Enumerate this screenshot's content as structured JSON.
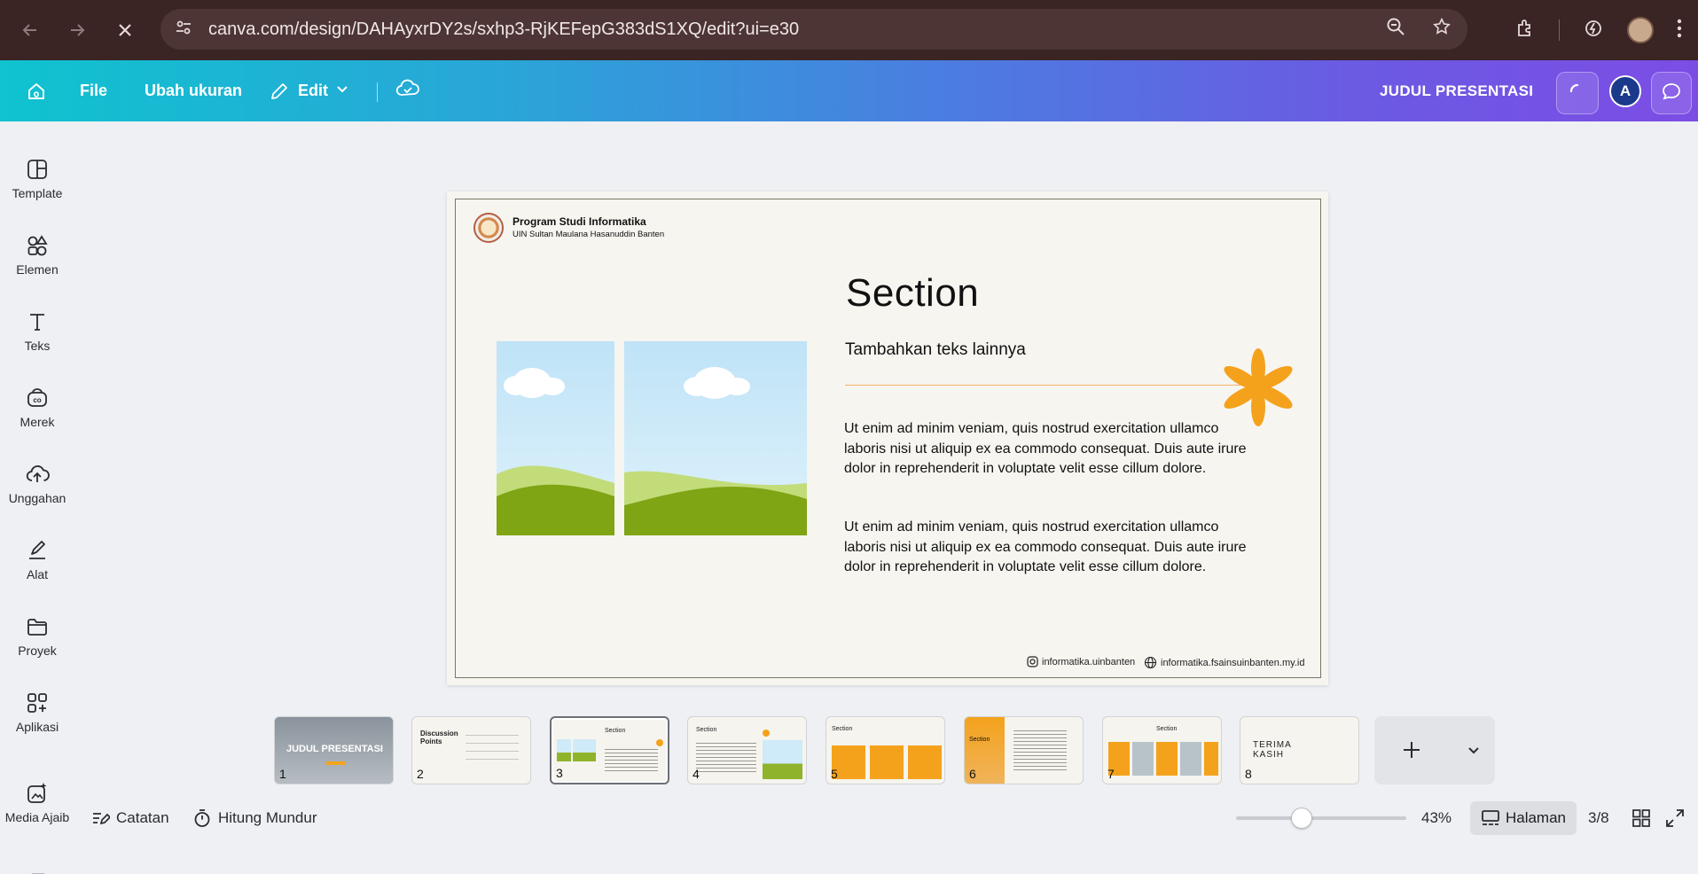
{
  "browser": {
    "url": "canva.com/design/DAHAyxrDY2s/sxhp3-RjKEFepG383dS1XQ/edit?ui=e30",
    "icons": [
      "back-icon",
      "forward-icon",
      "stop-icon",
      "site-settings-icon",
      "zoom-icon",
      "bookmark-star-icon",
      "extensions-icon",
      "performance-icon",
      "profile-avatar",
      "menu-icon"
    ]
  },
  "topbar": {
    "file": "File",
    "resize": "Ubah ukuran",
    "edit": "Edit",
    "title": "JUDUL PRESENTASI",
    "avatar_letter": "A"
  },
  "sidebar": {
    "items": [
      {
        "label": "Template",
        "icon": "template-icon"
      },
      {
        "label": "Elemen",
        "icon": "elements-icon"
      },
      {
        "label": "Teks",
        "icon": "text-icon"
      },
      {
        "label": "Merek",
        "icon": "brand-icon"
      },
      {
        "label": "Unggahan",
        "icon": "upload-cloud-icon"
      },
      {
        "label": "Alat",
        "icon": "draw-tool-icon"
      },
      {
        "label": "Proyek",
        "icon": "folder-icon"
      },
      {
        "label": "Aplikasi",
        "icon": "apps-icon"
      },
      {
        "label": "Media Ajaib",
        "icon": "magic-media-icon"
      }
    ]
  },
  "slide": {
    "org_name": "Program Studi Informatika",
    "org_sub": "UIN Sultan Maulana Hasanuddin Banten",
    "title": "Section",
    "subtitle": "Tambahkan teks lainnya",
    "paragraph1": "Ut enim ad minim veniam, quis nostrud exercitation ullamco laboris nisi ut aliquip ex ea commodo consequat. Duis aute irure dolor in reprehenderit in voluptate velit esse cillum dolore.",
    "paragraph2": "Ut enim ad minim veniam, quis nostrud exercitation ullamco laboris nisi ut aliquip ex ea commodo consequat. Duis aute irure dolor in reprehenderit in voluptate velit esse cillum dolore.",
    "footer_instagram": "informatika.uinbanten",
    "footer_web": "informatika.fsainsuinbanten.my.id",
    "accent_color": "#f4a21c"
  },
  "pages": {
    "thumbs": [
      {
        "num": "1",
        "text": "JUDUL PRESENTASI"
      },
      {
        "num": "2",
        "text": "Discussion Points"
      },
      {
        "num": "3",
        "text": "Section"
      },
      {
        "num": "4",
        "text": "Section"
      },
      {
        "num": "5",
        "text": "Section"
      },
      {
        "num": "6",
        "text": "Section"
      },
      {
        "num": "7",
        "text": "Section"
      },
      {
        "num": "8",
        "text": "TERIMA KASIH"
      }
    ],
    "selected": 3
  },
  "bottombar": {
    "notes": "Catatan",
    "timer": "Hitung Mundur",
    "zoom": "43%",
    "zoom_fraction": 0.43,
    "pages_btn": "Halaman",
    "page_count": "3/8"
  }
}
